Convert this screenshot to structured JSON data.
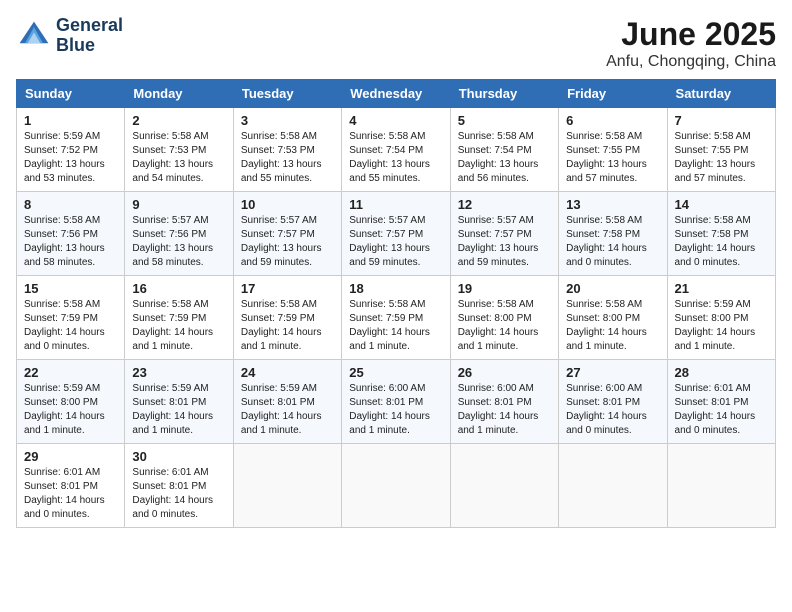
{
  "header": {
    "logo_line1": "General",
    "logo_line2": "Blue",
    "month": "June 2025",
    "location": "Anfu, Chongqing, China"
  },
  "weekdays": [
    "Sunday",
    "Monday",
    "Tuesday",
    "Wednesday",
    "Thursday",
    "Friday",
    "Saturday"
  ],
  "weeks": [
    [
      {
        "day": "1",
        "info": "Sunrise: 5:59 AM\nSunset: 7:52 PM\nDaylight: 13 hours\nand 53 minutes."
      },
      {
        "day": "2",
        "info": "Sunrise: 5:58 AM\nSunset: 7:53 PM\nDaylight: 13 hours\nand 54 minutes."
      },
      {
        "day": "3",
        "info": "Sunrise: 5:58 AM\nSunset: 7:53 PM\nDaylight: 13 hours\nand 55 minutes."
      },
      {
        "day": "4",
        "info": "Sunrise: 5:58 AM\nSunset: 7:54 PM\nDaylight: 13 hours\nand 55 minutes."
      },
      {
        "day": "5",
        "info": "Sunrise: 5:58 AM\nSunset: 7:54 PM\nDaylight: 13 hours\nand 56 minutes."
      },
      {
        "day": "6",
        "info": "Sunrise: 5:58 AM\nSunset: 7:55 PM\nDaylight: 13 hours\nand 57 minutes."
      },
      {
        "day": "7",
        "info": "Sunrise: 5:58 AM\nSunset: 7:55 PM\nDaylight: 13 hours\nand 57 minutes."
      }
    ],
    [
      {
        "day": "8",
        "info": "Sunrise: 5:58 AM\nSunset: 7:56 PM\nDaylight: 13 hours\nand 58 minutes."
      },
      {
        "day": "9",
        "info": "Sunrise: 5:57 AM\nSunset: 7:56 PM\nDaylight: 13 hours\nand 58 minutes."
      },
      {
        "day": "10",
        "info": "Sunrise: 5:57 AM\nSunset: 7:57 PM\nDaylight: 13 hours\nand 59 minutes."
      },
      {
        "day": "11",
        "info": "Sunrise: 5:57 AM\nSunset: 7:57 PM\nDaylight: 13 hours\nand 59 minutes."
      },
      {
        "day": "12",
        "info": "Sunrise: 5:57 AM\nSunset: 7:57 PM\nDaylight: 13 hours\nand 59 minutes."
      },
      {
        "day": "13",
        "info": "Sunrise: 5:58 AM\nSunset: 7:58 PM\nDaylight: 14 hours\nand 0 minutes."
      },
      {
        "day": "14",
        "info": "Sunrise: 5:58 AM\nSunset: 7:58 PM\nDaylight: 14 hours\nand 0 minutes."
      }
    ],
    [
      {
        "day": "15",
        "info": "Sunrise: 5:58 AM\nSunset: 7:59 PM\nDaylight: 14 hours\nand 0 minutes."
      },
      {
        "day": "16",
        "info": "Sunrise: 5:58 AM\nSunset: 7:59 PM\nDaylight: 14 hours\nand 1 minute."
      },
      {
        "day": "17",
        "info": "Sunrise: 5:58 AM\nSunset: 7:59 PM\nDaylight: 14 hours\nand 1 minute."
      },
      {
        "day": "18",
        "info": "Sunrise: 5:58 AM\nSunset: 7:59 PM\nDaylight: 14 hours\nand 1 minute."
      },
      {
        "day": "19",
        "info": "Sunrise: 5:58 AM\nSunset: 8:00 PM\nDaylight: 14 hours\nand 1 minute."
      },
      {
        "day": "20",
        "info": "Sunrise: 5:58 AM\nSunset: 8:00 PM\nDaylight: 14 hours\nand 1 minute."
      },
      {
        "day": "21",
        "info": "Sunrise: 5:59 AM\nSunset: 8:00 PM\nDaylight: 14 hours\nand 1 minute."
      }
    ],
    [
      {
        "day": "22",
        "info": "Sunrise: 5:59 AM\nSunset: 8:00 PM\nDaylight: 14 hours\nand 1 minute."
      },
      {
        "day": "23",
        "info": "Sunrise: 5:59 AM\nSunset: 8:01 PM\nDaylight: 14 hours\nand 1 minute."
      },
      {
        "day": "24",
        "info": "Sunrise: 5:59 AM\nSunset: 8:01 PM\nDaylight: 14 hours\nand 1 minute."
      },
      {
        "day": "25",
        "info": "Sunrise: 6:00 AM\nSunset: 8:01 PM\nDaylight: 14 hours\nand 1 minute."
      },
      {
        "day": "26",
        "info": "Sunrise: 6:00 AM\nSunset: 8:01 PM\nDaylight: 14 hours\nand 1 minute."
      },
      {
        "day": "27",
        "info": "Sunrise: 6:00 AM\nSunset: 8:01 PM\nDaylight: 14 hours\nand 0 minutes."
      },
      {
        "day": "28",
        "info": "Sunrise: 6:01 AM\nSunset: 8:01 PM\nDaylight: 14 hours\nand 0 minutes."
      }
    ],
    [
      {
        "day": "29",
        "info": "Sunrise: 6:01 AM\nSunset: 8:01 PM\nDaylight: 14 hours\nand 0 minutes."
      },
      {
        "day": "30",
        "info": "Sunrise: 6:01 AM\nSunset: 8:01 PM\nDaylight: 14 hours\nand 0 minutes."
      },
      {
        "day": "",
        "info": ""
      },
      {
        "day": "",
        "info": ""
      },
      {
        "day": "",
        "info": ""
      },
      {
        "day": "",
        "info": ""
      },
      {
        "day": "",
        "info": ""
      }
    ]
  ]
}
